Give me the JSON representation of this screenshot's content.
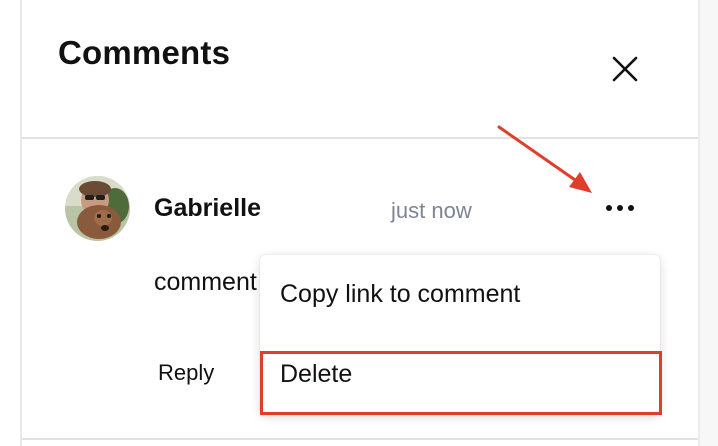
{
  "panel": {
    "title": "Comments",
    "close_icon": "close-icon"
  },
  "comment": {
    "author": "Gabrielle",
    "time": "just now",
    "text": "comment",
    "reply_label": "Reply",
    "more_icon": "more-horizontal-icon",
    "avatar": "avatar-photo"
  },
  "menu": {
    "items": [
      {
        "label": "Copy link to comment"
      },
      {
        "label": "Delete"
      }
    ]
  },
  "annotation": {
    "color": "#e03e2d",
    "arrow": "arrow-pointing-to-more-options",
    "highlight": "delete-menu-item-outline"
  }
}
